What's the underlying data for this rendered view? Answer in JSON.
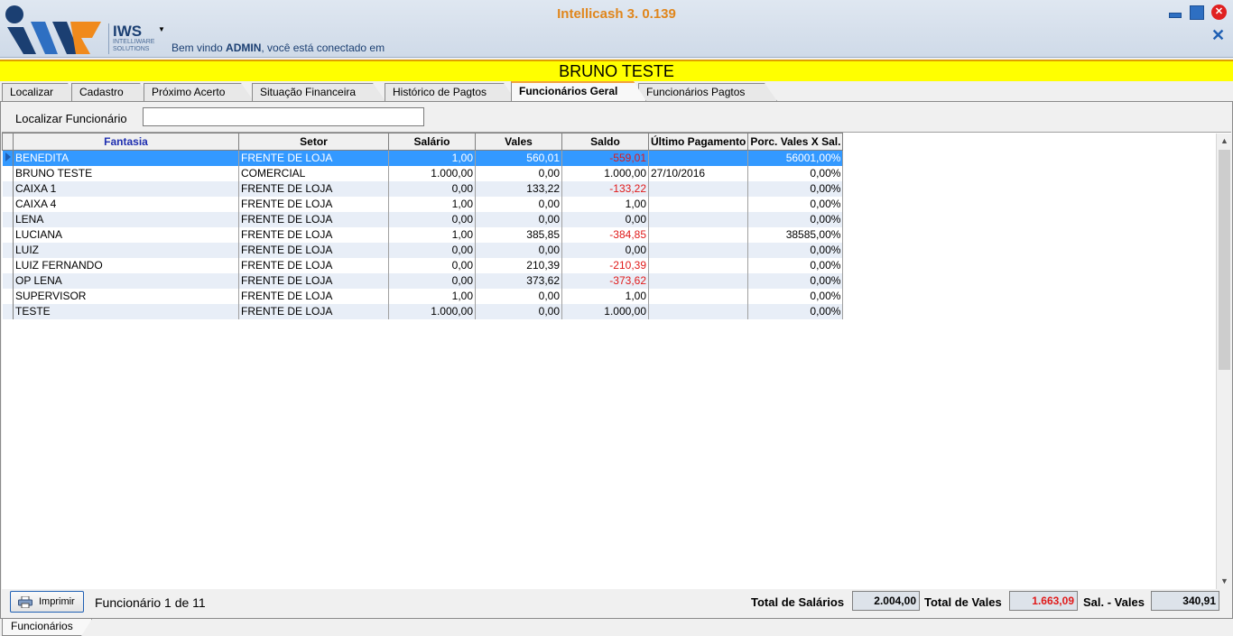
{
  "window": {
    "title": "Intellicash 3. 0.139",
    "welcome_prefix": "Bem vindo ",
    "welcome_user": "ADMIN",
    "welcome_suffix": ", você está conectado em"
  },
  "logo": {
    "brand": "IWS",
    "subtitle_line1": "INTELLIWARE",
    "subtitle_line2": "SOLUTIONS"
  },
  "client_name": "BRUNO TESTE",
  "tabs": [
    {
      "label": "Localizar"
    },
    {
      "label": "Cadastro"
    },
    {
      "label": "Próximo Acerto"
    },
    {
      "label": "Situação Financeira"
    },
    {
      "label": "Histórico de Pagtos"
    },
    {
      "label": "Funcionários Geral",
      "active": true
    },
    {
      "label": "Funcionários Pagtos"
    }
  ],
  "search": {
    "label": "Localizar Funcionário",
    "value": ""
  },
  "grid": {
    "columns": [
      "Fantasia",
      "Setor",
      "Salário",
      "Vales",
      "Saldo",
      "Último Pagamento",
      "Porc. Vales X Sal."
    ],
    "rows": [
      [
        "BENEDITA",
        "FRENTE DE LOJA",
        "1,00",
        "560,01",
        "-559,01",
        "",
        "56001,00%"
      ],
      [
        "BRUNO TESTE",
        "COMERCIAL",
        "1.000,00",
        "0,00",
        "1.000,00",
        "27/10/2016",
        "0,00%"
      ],
      [
        "CAIXA 1",
        "FRENTE DE LOJA",
        "0,00",
        "133,22",
        "-133,22",
        "",
        "0,00%"
      ],
      [
        "CAIXA 4",
        "FRENTE DE LOJA",
        "1,00",
        "0,00",
        "1,00",
        "",
        "0,00%"
      ],
      [
        "LENA",
        "FRENTE DE LOJA",
        "0,00",
        "0,00",
        "0,00",
        "",
        "0,00%"
      ],
      [
        "LUCIANA",
        "FRENTE DE LOJA",
        "1,00",
        "385,85",
        "-384,85",
        "",
        "38585,00%"
      ],
      [
        "LUIZ",
        "FRENTE DE LOJA",
        "0,00",
        "0,00",
        "0,00",
        "",
        "0,00%"
      ],
      [
        "LUIZ FERNANDO",
        "FRENTE DE LOJA",
        "0,00",
        "210,39",
        "-210,39",
        "",
        "0,00%"
      ],
      [
        "OP LENA",
        "FRENTE DE LOJA",
        "0,00",
        "373,62",
        "-373,62",
        "",
        "0,00%"
      ],
      [
        "SUPERVISOR",
        "FRENTE DE LOJA",
        "1,00",
        "0,00",
        "1,00",
        "",
        "0,00%"
      ],
      [
        "TESTE",
        "FRENTE DE LOJA",
        "1.000,00",
        "0,00",
        "1.000,00",
        "",
        "0,00%"
      ]
    ]
  },
  "footer": {
    "print_label": "Imprimir",
    "record_count": "Funcionário 1 de 11",
    "total_salarios_label": "Total de Salários",
    "total_salarios": "2.004,00",
    "total_vales_label": "Total de Vales",
    "total_vales": "1.663,09",
    "sal_vales_label": "Sal. - Vales",
    "sal_vales": "340,91"
  },
  "bottom_tab": {
    "label": "Funcionários"
  },
  "colors": {
    "title_orange": "#e0861c",
    "client_bar": "#ffff00",
    "selection": "#3399ff",
    "negative": "#e01a1a"
  }
}
